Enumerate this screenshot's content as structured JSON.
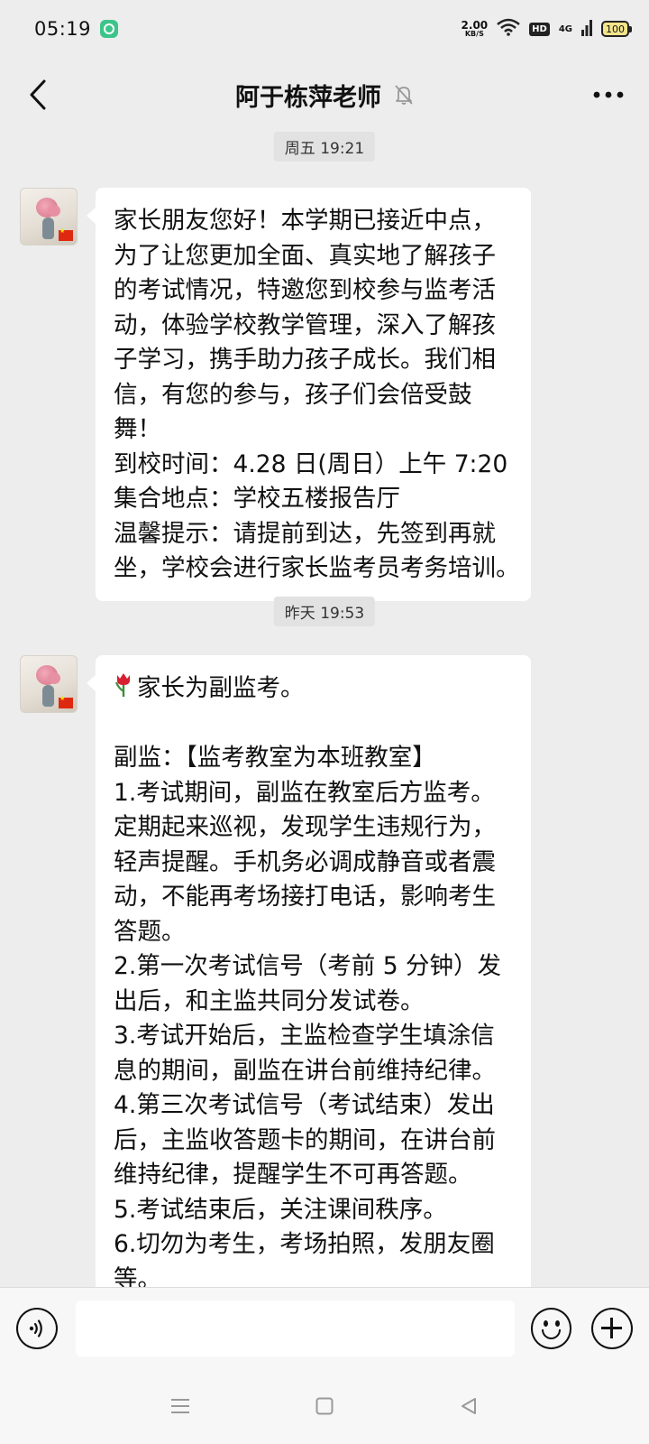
{
  "status_bar": {
    "time": "05:19",
    "net_speed_value": "2.00",
    "net_speed_unit": "KB/S",
    "hd_label": "HD",
    "network_label": "4G",
    "battery_label": "100"
  },
  "header": {
    "title": "阿于栋萍老师"
  },
  "chat": {
    "messages": [
      {
        "timestamp": "周五 19:21",
        "lines": [
          "家长朋友您好！本学期已接近中点，",
          "为了让您更加全面、真实地了解孩子",
          "的考试情况，特邀您到校参与监考活",
          "动，体验学校教学管理，深入了解孩",
          "子学习，携手助力孩子成长。我们相",
          "信，有您的参与，孩子们会倍受鼓",
          "舞！",
          "到校时间：4.28 日(周日）上午 7:20",
          "集合地点：学校五楼报告厅",
          "温馨提示：请提前到达，先签到再就",
          "坐，学校会进行家长监考员考务培训。"
        ]
      },
      {
        "timestamp": "昨天 19:53",
        "first_line": "家长为副监考。",
        "lines": [
          "副监：【监考教室为本班教室】",
          "1.考试期间，副监在教室后方监考。",
          "定期起来巡视，发现学生违规行为，",
          "轻声提醒。手机务必调成静音或者震",
          "动，不能再考场接打电话，影响考生",
          "答题。",
          "2.第一次考试信号（考前 5 分钟）发",
          "出后，和主监共同分发试卷。",
          "3.考试开始后，主监检查学生填涂信",
          "息的期间，副监在讲台前维持纪律。",
          "4.第三次考试信号（考试结束）发出",
          "后，主监收答题卡的期间，在讲台前",
          "维持纪律，提醒学生不可再答题。",
          "5.考试结束后，关注课间秩序。",
          "6.切勿为考生，考场拍照，发朋友圈",
          "等。"
        ]
      }
    ]
  },
  "input": {
    "value": "",
    "placeholder": ""
  },
  "icons": {
    "back": "back-chevron-icon",
    "mute": "bell-muted-icon",
    "more": "more-dots-icon",
    "voice": "voice-icon",
    "emoji": "emoji-icon",
    "plus": "plus-icon",
    "tulip": "tulip-emoji-icon",
    "nav_menu": "menu-icon",
    "nav_home": "home-square-icon",
    "nav_back": "back-triangle-icon"
  },
  "colors": {
    "chat_background": "#ededed",
    "bubble_background": "#ffffff",
    "timestamp_pill": "#e2e2e2"
  }
}
